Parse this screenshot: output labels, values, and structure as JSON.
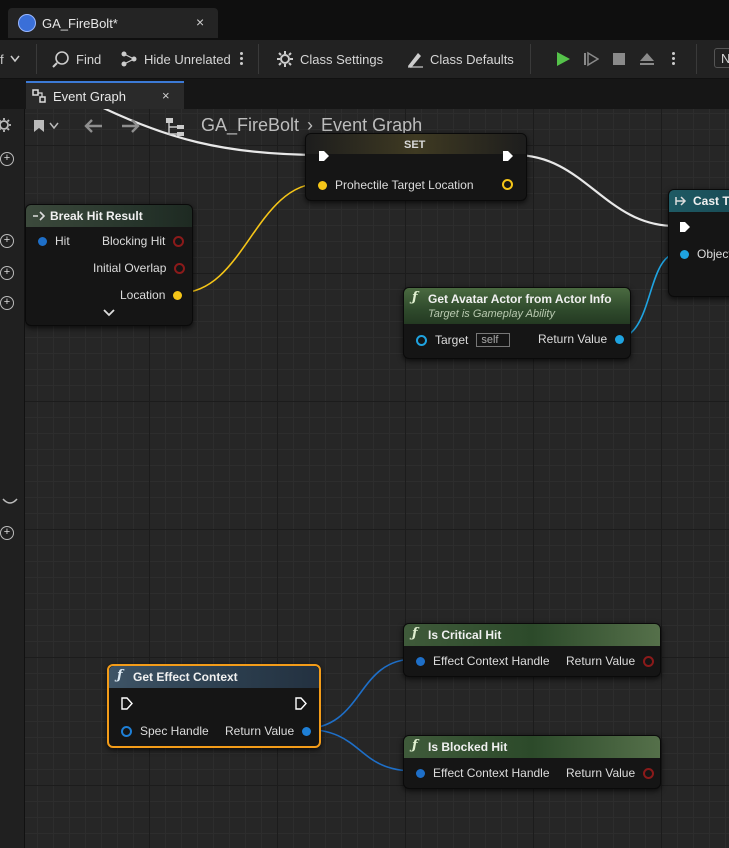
{
  "doc_tab": {
    "title": "GA_FireBolt*",
    "close": "×"
  },
  "toolbar": {
    "find_label": "Find",
    "hide_unrelated_label": "Hide Unrelated",
    "class_settings_label": "Class Settings",
    "class_defaults_label": "Class Defaults",
    "edge_text": "N"
  },
  "graph_tab": {
    "label": "Event Graph",
    "close": "×"
  },
  "breadcrumb": {
    "blueprint": "GA_FireBolt",
    "separator": "›",
    "graph": "Event Graph"
  },
  "nodes": {
    "set": {
      "title": "SET",
      "pin": "Prohectile Target Location"
    },
    "break_hit": {
      "title": "Break Hit Result",
      "hit": "Hit",
      "blocking_hit": "Blocking Hit",
      "initial_overlap": "Initial Overlap",
      "location": "Location"
    },
    "avatar": {
      "title": "Get Avatar Actor from Actor Info",
      "subtitle": "Target is Gameplay Ability",
      "target": "Target",
      "target_value": "self",
      "return": "Return Value"
    },
    "cast": {
      "title": "Cast To",
      "object": "Object"
    },
    "effect_ctx": {
      "title": "Get Effect Context",
      "spec": "Spec Handle",
      "return": "Return Value"
    },
    "critical": {
      "title": "Is Critical Hit",
      "ctx": "Effect Context Handle",
      "return": "Return Value"
    },
    "blocked": {
      "title": "Is Blocked Hit",
      "ctx": "Effect Context Handle",
      "return": "Return Value"
    }
  },
  "colors": {
    "exec": "#ffffff",
    "vector": "#f5c518",
    "struct": "#1e7fd6",
    "bool": "#8b1a1a",
    "object": "#1fa3e0",
    "selected": "#f39c19",
    "play": "#55c24a"
  }
}
